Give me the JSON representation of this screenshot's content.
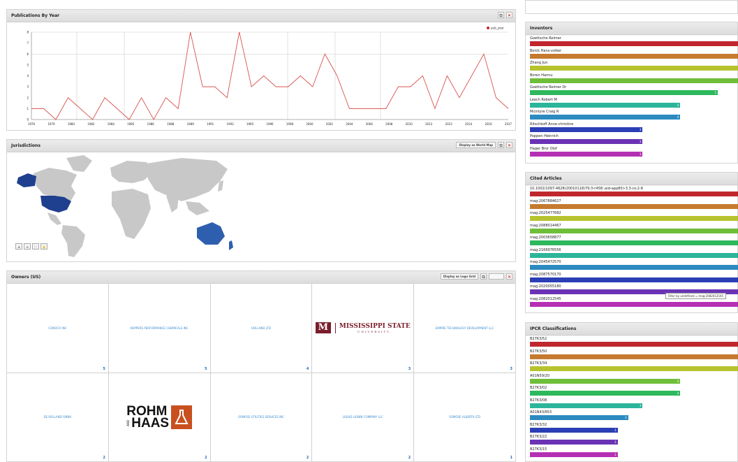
{
  "pub_panel": {
    "title": "Publications By Year",
    "legend": "pub_year",
    "chart_data": {
      "type": "line",
      "x": [
        "1976",
        "1979",
        "1980",
        "1982",
        "1984",
        "1985",
        "1986",
        "1987",
        "1988",
        "1989",
        "1991",
        "1992",
        "1993",
        "1994",
        "1995",
        "1996",
        "1997",
        "1998",
        "1999",
        "2001",
        "2002",
        "2003",
        "2004",
        "2005",
        "2006",
        "2007",
        "2008",
        "2009",
        "2010",
        "2011",
        "2012",
        "2013",
        "2014",
        "2015",
        "2016",
        "2017"
      ],
      "values": [
        1,
        1,
        0,
        2,
        1,
        0,
        2,
        1,
        0,
        2,
        0,
        2,
        1,
        8,
        3,
        3,
        2,
        8,
        3,
        4,
        3,
        3,
        4,
        3,
        6,
        4,
        1,
        1,
        1,
        1,
        3,
        3,
        4,
        1,
        4,
        2,
        4,
        6,
        2,
        1
      ],
      "xticks": [
        "1976",
        "1979",
        "1980",
        "1982",
        "1984",
        "1985",
        "1986",
        "1988",
        "1989",
        "1991",
        "1993",
        "1995",
        "1996",
        "1998",
        "2000",
        "2002",
        "2004",
        "2006",
        "2008",
        "2010",
        "2012",
        "2013",
        "2014",
        "2016",
        "2017"
      ],
      "yticks": [
        "0",
        "1",
        "2",
        "3",
        "4",
        "5",
        "6",
        "7",
        "8"
      ],
      "ylim": [
        0,
        8
      ],
      "color": "#d9534f"
    }
  },
  "jur_panel": {
    "title": "Jurisdictions",
    "display_select": "Display as World Map",
    "zoom_buttons": [
      "⊕",
      "⊖",
      "⛶",
      "✋"
    ],
    "colors": {
      "land": "#c8c8c8",
      "highlight": "#1f3f8f",
      "australia": "#2d5fae"
    }
  },
  "owners_panel": {
    "title": "Owners (US)",
    "display_select": "Display as Logo Grid",
    "extra_button": "",
    "cells": [
      {
        "name": "CONOCO INC",
        "count": "5"
      },
      {
        "name": "KOPPERS PERFORMANCE CHEMICALS INC",
        "count": "5"
      },
      {
        "name": "HOLLAND LTD",
        "count": "4"
      },
      {
        "name": "",
        "logo": "mississippi",
        "logo_text1": "MISSISSIPPI STATE",
        "logo_text2": "UNIVERSITY.",
        "count": "3"
      },
      {
        "name": "EMPIRE TECHNOLOGY DEVELOPMENT LLC",
        "count": "3"
      },
      {
        "name": "DE ROLLAND GMBH",
        "count": "2"
      },
      {
        "name": "",
        "logo": "rohm",
        "logo_text1": "ROHM",
        "logo_text2": "HAAS",
        "logo_text3": "AND",
        "count": "2"
      },
      {
        "name": "OSMOSE UTILITIES SERVICES INC",
        "count": "2"
      },
      {
        "name": "LIQUID LIGNIN COMPANY LLC",
        "count": "2"
      },
      {
        "name": "OSMOSE ALBERTA LTD",
        "count": "1"
      }
    ]
  },
  "inventors_panel": {
    "title": "Inventors",
    "rows": [
      {
        "label": "Goettsche Reimer",
        "frac": 1.0,
        "color": "#c0272d",
        "count": ""
      },
      {
        "label": "Borck Hans-volker",
        "frac": 1.0,
        "color": "#c57a30",
        "count": ""
      },
      {
        "label": "Zhang Jun",
        "frac": 1.0,
        "color": "#b6c32e",
        "count": ""
      },
      {
        "label": "Boren Hannu",
        "frac": 1.0,
        "color": "#6fbe3a",
        "count": ""
      },
      {
        "label": "Goettsche Reimer Dr",
        "frac": 0.9,
        "color": "#2db85c",
        "count": "5"
      },
      {
        "label": "Leach Robert M",
        "frac": 0.72,
        "color": "#2cb59a",
        "count": "4"
      },
      {
        "label": "Mcintyre Craig R",
        "frac": 0.72,
        "color": "#2c8ac0",
        "count": "4"
      },
      {
        "label": "Ritschkoff Anne-christine",
        "frac": 0.54,
        "color": "#2a3fb5",
        "count": "3"
      },
      {
        "label": "Poppen Heinrich",
        "frac": 0.54,
        "color": "#6a33b5",
        "count": "3"
      },
      {
        "label": "Hager Bror Olof",
        "frac": 0.54,
        "color": "#b52fb5",
        "count": "3"
      }
    ]
  },
  "cited_panel": {
    "title": "Cited Articles",
    "tooltip": "Filter by undefined = mag:2082012545",
    "rows": [
      {
        "label": "10.1002/1097-4628(20010118)79:3<458::aid-app80>3.3.co;2-8",
        "frac": 1.0,
        "color": "#c0272d"
      },
      {
        "label": "mag:2067884627",
        "frac": 1.0,
        "color": "#c57a30"
      },
      {
        "label": "mag:2025477682",
        "frac": 1.0,
        "color": "#b6c32e"
      },
      {
        "label": "mag:2088014467",
        "frac": 1.0,
        "color": "#6fbe3a"
      },
      {
        "label": "mag:2003658877",
        "frac": 1.0,
        "color": "#2db85c"
      },
      {
        "label": "mag:2166976556",
        "frac": 1.0,
        "color": "#2cb59a"
      },
      {
        "label": "mag:2045472570",
        "frac": 1.0,
        "color": "#2c8ac0"
      },
      {
        "label": "mag:2087570170",
        "frac": 1.0,
        "color": "#2a3fb5"
      },
      {
        "label": "mag:2020055180",
        "frac": 1.0,
        "color": "#6a33b5"
      },
      {
        "label": "mag:2082012545",
        "frac": 1.0,
        "color": "#b52fb5"
      }
    ]
  },
  "ipcr_panel": {
    "title": "IPCR Classifications",
    "rows": [
      {
        "label": "B27K3/52",
        "frac": 1.0,
        "color": "#c0272d",
        "count": ""
      },
      {
        "label": "B27K3/50",
        "frac": 1.0,
        "color": "#c57a30",
        "count": ""
      },
      {
        "label": "B27K3/34",
        "frac": 1.0,
        "color": "#b6c32e",
        "count": ""
      },
      {
        "label": "A01N59/20",
        "frac": 0.72,
        "color": "#6fbe3a",
        "count": "4"
      },
      {
        "label": "B27K3/02",
        "frac": 0.72,
        "color": "#2db85c",
        "count": "4"
      },
      {
        "label": "B27K3/08",
        "frac": 0.54,
        "color": "#2cb59a",
        "count": "3"
      },
      {
        "label": "A01N43/653",
        "frac": 0.47,
        "color": "#2c8ac0",
        "count": "3"
      },
      {
        "label": "B27K3/32",
        "frac": 0.42,
        "color": "#2a3fb5",
        "count": "3"
      },
      {
        "label": "B27K3/22",
        "frac": 0.42,
        "color": "#6a33b5",
        "count": "3"
      },
      {
        "label": "B27K3/15",
        "frac": 0.42,
        "color": "#b52fb5",
        "count": "3"
      }
    ]
  }
}
